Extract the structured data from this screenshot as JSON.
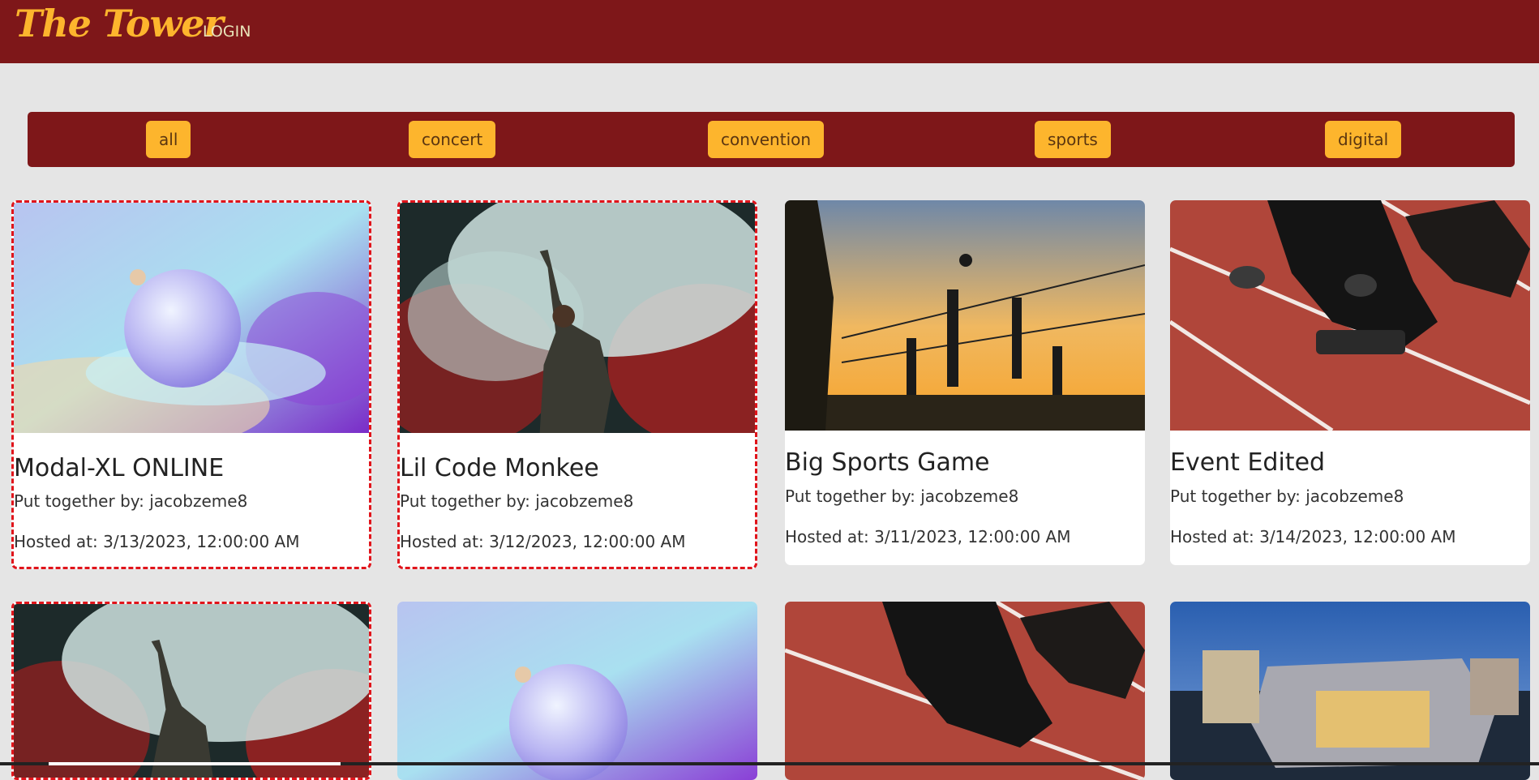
{
  "navbar": {
    "brand": "The Tower",
    "login_label": "LOGIN"
  },
  "filters": [
    "all",
    "concert",
    "convention",
    "sports",
    "digital"
  ],
  "events": [
    {
      "title": "Modal-XL ONLINE",
      "by": "Put together by: jacobzeme8",
      "hosted": "Hosted at: 3/13/2023, 12:00:00 AM",
      "image": "digital-sphere"
    },
    {
      "title": "Lil Code Monkee",
      "by": "Put together by: jacobzeme8",
      "hosted": "Hosted at: 3/12/2023, 12:00:00 AM",
      "image": "concert-smoke"
    },
    {
      "title": "Big Sports Game",
      "by": "Put together by: jacobzeme8",
      "hosted": "Hosted at: 3/11/2023, 12:00:00 AM",
      "image": "volleyball-sunset"
    },
    {
      "title": "Event Edited",
      "by": "Put together by: jacobzeme8",
      "hosted": "Hosted at: 3/14/2023, 12:00:00 AM",
      "image": "runner-track"
    },
    {
      "image": "concert-smoke"
    },
    {
      "image": "digital-sphere"
    },
    {
      "image": "runner-track"
    },
    {
      "image": "arena-night"
    }
  ],
  "colors": {
    "navbar": "#7e1719",
    "accent": "#fdb52d",
    "selected_border": "#e0141b",
    "page_bg": "#e5e5e5"
  }
}
